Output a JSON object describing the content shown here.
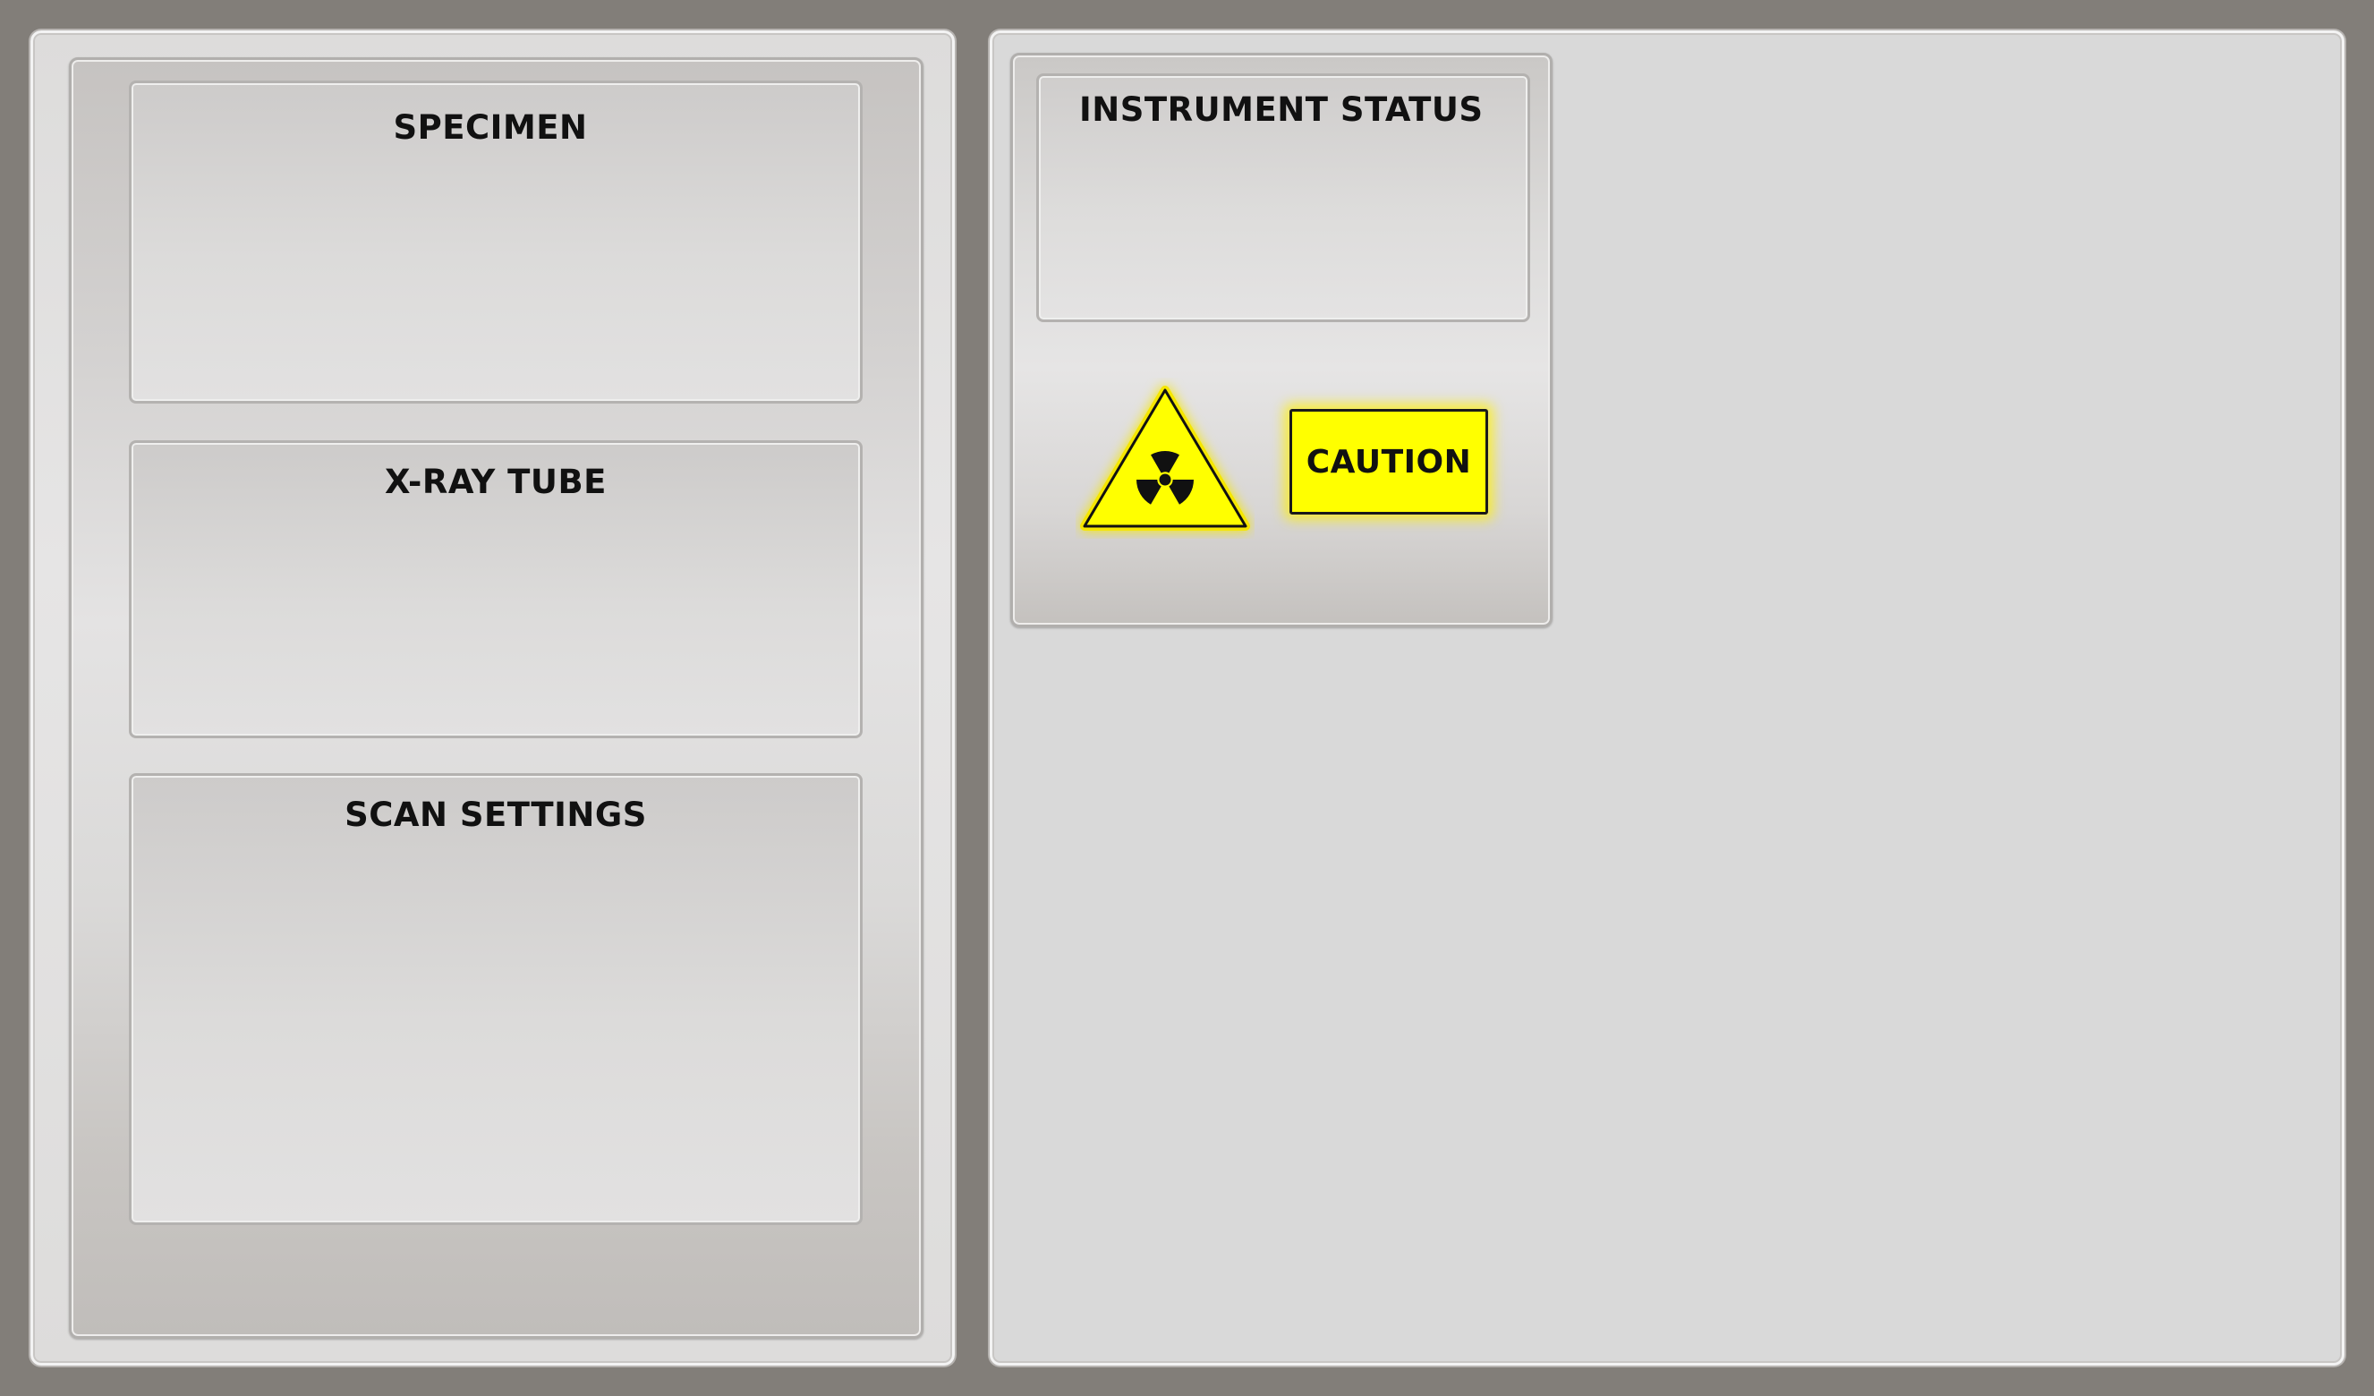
{
  "left_panel": {
    "sections": [
      {
        "title": "SPECIMEN"
      },
      {
        "title": "X-RAY TUBE"
      },
      {
        "title": "SCAN SETTINGS"
      }
    ]
  },
  "status_panel": {
    "title": "INSTRUMENT STATUS",
    "radiation_icon": "radiation-warning-triangle",
    "caution_label": "CAUTION",
    "warning_color": "#ffff00"
  },
  "colors": {
    "background": "#827e79",
    "panel": "#d9d9d9",
    "text": "#111111"
  }
}
